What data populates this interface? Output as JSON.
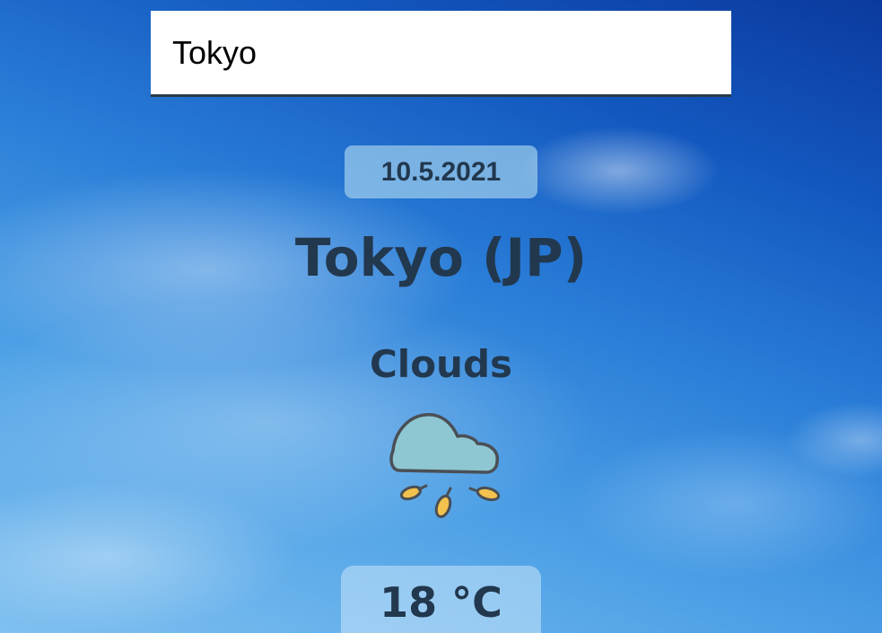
{
  "search": {
    "value": "Tokyo"
  },
  "weather": {
    "date": "10.5.2021",
    "location": "Tokyo (JP)",
    "condition": "Clouds",
    "icon": "cloud-with-falling-leaves-icon",
    "temperature": "18 °C"
  },
  "colors": {
    "text": "#22384e",
    "cloud_fill": "#8ec7d2",
    "leaf_fill": "#f2c14e"
  }
}
